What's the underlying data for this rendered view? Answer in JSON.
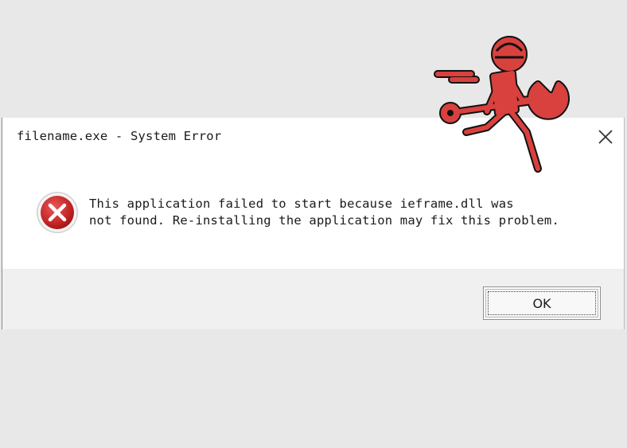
{
  "window": {
    "title": "filename.exe - System Error",
    "close_icon": "close-icon"
  },
  "dialog": {
    "icon": "error-icon",
    "message_line1": "This application failed to start because ieframe.dll was",
    "message_line2": "not found. Re-installing the application may fix this problem.",
    "ok_label": "OK"
  },
  "illustration": {
    "name": "running-repairman-with-wrench",
    "color": "#d9413e"
  },
  "colors": {
    "error_red": "#c92a2a",
    "dialog_background": "#ffffff",
    "footer_background": "#f0f0f0",
    "page_background": "#e8e8e8"
  }
}
